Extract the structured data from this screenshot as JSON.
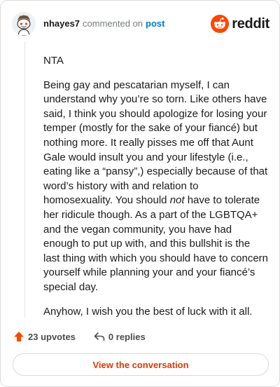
{
  "header": {
    "username": "nhayes7",
    "verb": "commented on",
    "post_link": "post",
    "brand": "reddit"
  },
  "comment": {
    "paragraphs": {
      "p1": "NTA",
      "p2_before_em": "Being gay and pescatarian myself, I can understand why you’re so torn. Like others have said, I think you should apologize for losing your temper (mostly for the sake of your fiancé) but nothing more. It really pisses me off that Aunt Gale would insult you and your lifestyle (i.e., eating like a “pansy”,) especially because of that word’s history with and relation to homosexuality. You should ",
      "p2_em": "not",
      "p2_after_em": " have to tolerate her ridicule though. As a part of the LGBTQA+ and the vegan community, you have had enough to put up with, and this bullshit is the last thing with which you should have to concern yourself while planning your and your fiancé’s special day.",
      "p3": "Anyhow, I wish you the best of luck with it all."
    }
  },
  "actions": {
    "upvotes": "23 upvotes",
    "replies": "0 replies"
  },
  "cta": {
    "label": "View the conversation"
  },
  "colors": {
    "upvote_orange": "#ff4500",
    "link_blue": "#0079d3",
    "cta_text": "#d93a00"
  }
}
